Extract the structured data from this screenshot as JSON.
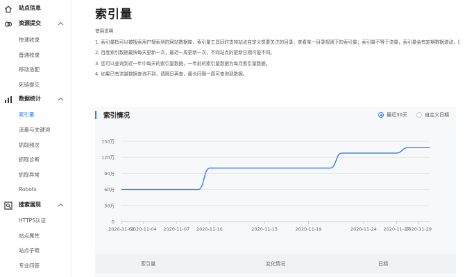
{
  "sidebar": {
    "top_item": "站点信息",
    "groups": [
      {
        "label": "资源提交",
        "items": [
          "快速收录",
          "普通收录",
          "移动适配",
          "死链提交"
        ]
      },
      {
        "label": "数据统计",
        "items": [
          "索引量",
          "流量与关键词",
          "抓取频次",
          "抓取诊断",
          "抓取异常",
          "Robots"
        ]
      },
      {
        "label": "搜索展现",
        "items": [
          "HTTPS认证",
          "站点属性",
          "站点子链",
          "专业问答"
        ]
      }
    ],
    "active_item": "索引量"
  },
  "main": {
    "title": "索引量",
    "notes_title": "使用说明",
    "notes": [
      "1. 索引量指可以被搜索用户搜索到的网站数据库，索引量工具同时支持站点自定义想要关注的目录，查看某一目录规则下的索引量；索引量不等于流量，索引量会有定期数据波动，属于正常现象。",
      "2. 百度索引数据最快每天更新一次，最迟一周更新一次，不同站点的更新日期可能不同。",
      "3. 您可以查询到近一年中每天的索引量数据，一年前的索引量数据为每月索引量数据。",
      "4. 如果已有流量数据查询不到，请隔日再查，最长间隔一周可查询到数据。"
    ]
  },
  "card": {
    "title": "索引情况",
    "radio_recent": "最近30天",
    "radio_custom": "自定义日期",
    "selected": "最近30天"
  },
  "table": {
    "headers": [
      "索引量",
      "变化情况",
      "日期"
    ]
  },
  "colors": {
    "accent": "#2f7cf6",
    "line": "#2f7cf6",
    "grid": "#e6e6e6"
  },
  "chart_data": {
    "type": "line",
    "title": "",
    "xlabel": "",
    "ylabel": "",
    "ylim": [
      0,
      150
    ],
    "yticks": [
      0,
      30,
      60,
      90,
      120,
      150
    ],
    "ytick_labels": [
      "0",
      "30万",
      "60万",
      "90万",
      "120万",
      "150万"
    ],
    "xtick_labels": [
      "2020-11-02",
      "2020-11-04",
      "2020-11-07",
      "2020-11-10",
      "2020-11-15",
      "2020-11-19",
      "2020-11-24",
      "2020-11-27",
      "2020-11-29"
    ],
    "series": [
      {
        "x": [
          "2020-11-02",
          "2020-11-07",
          "2020-11-09",
          "2020-11-10",
          "2020-11-19",
          "2020-11-21",
          "2020-11-22",
          "2020-11-27",
          "2020-11-28",
          "2020-11-29",
          "2020-11-30"
        ],
        "values": [
          60,
          60,
          60,
          100,
          100,
          100,
          128,
          128,
          138,
          138,
          138
        ]
      }
    ],
    "grid": true
  }
}
